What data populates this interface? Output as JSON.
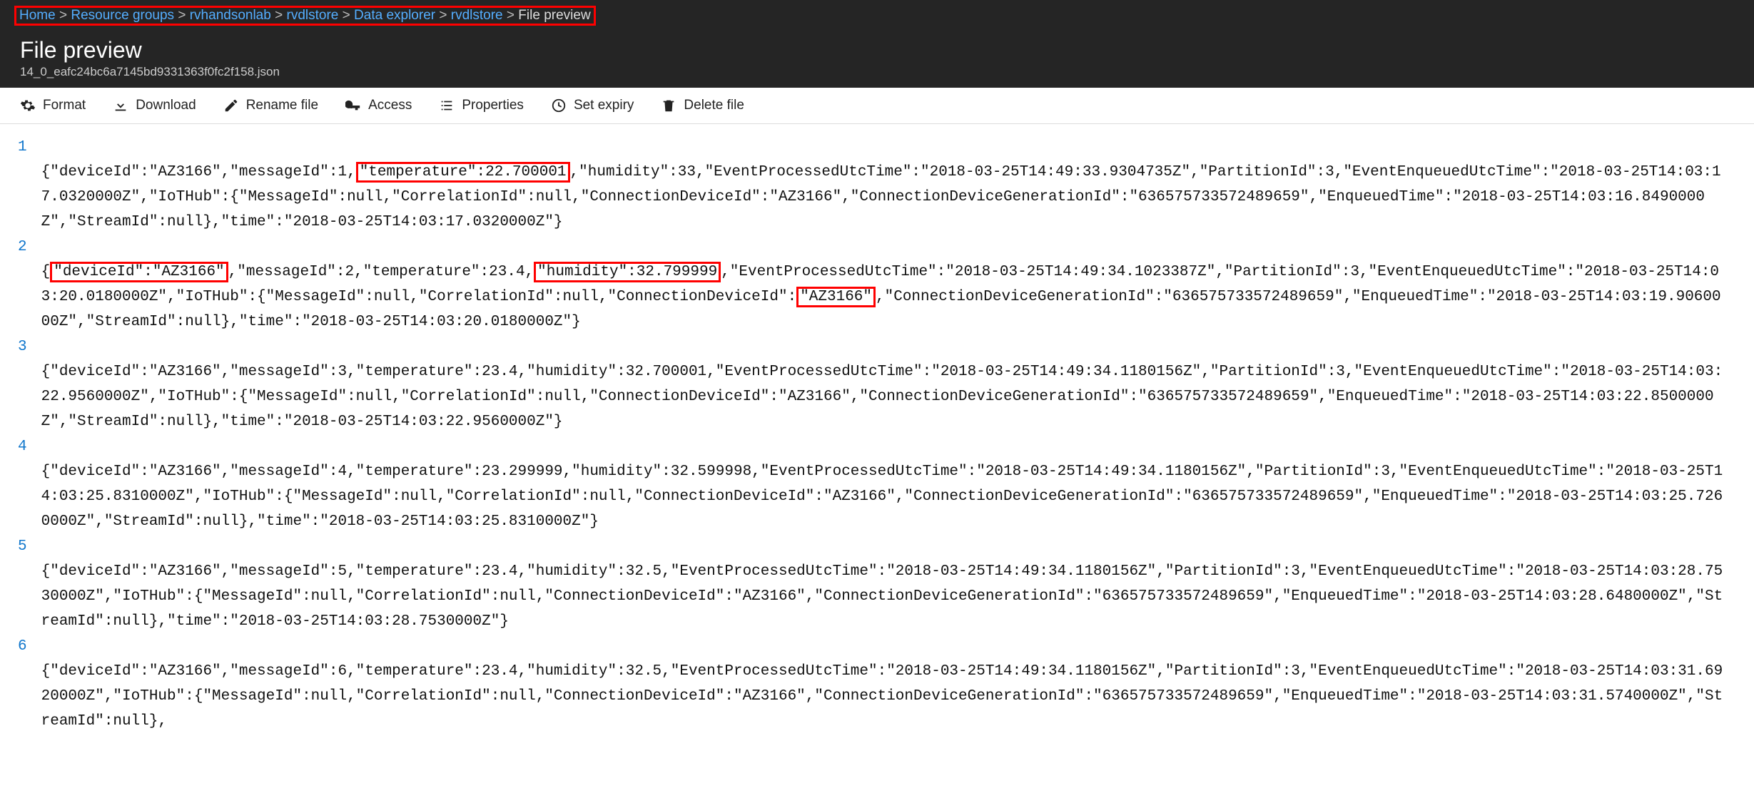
{
  "breadcrumb": {
    "items": [
      "Home",
      "Resource groups",
      "rvhandsonlab",
      "rvdlstore",
      "Data explorer",
      "rvdlstore",
      "File preview"
    ]
  },
  "header": {
    "title": "File preview",
    "subtitle": "14_0_eafc24bc6a7145bd9331363f0fc2f158.json"
  },
  "toolbar": {
    "format": "Format",
    "download": "Download",
    "rename": "Rename file",
    "access": "Access",
    "properties": "Properties",
    "setexpiry": "Set expiry",
    "deletefile": "Delete file"
  },
  "records": [
    {
      "n": 1,
      "pre": "{\"deviceId\":\"AZ3166\",\"messageId\":1,",
      "hl1": "\"temperature\":22.700001",
      "mid": ",\"humidity\":33,\"EventProcessedUtcTime\":\"2018-03-25T14:49:33.9304735Z\",\"PartitionId\":3,\"EventEnqueuedUtcTime\":\"2018-03-25T14:03:17.0320000Z\",\"IoTHub\":{\"MessageId\":null,\"CorrelationId\":null,\"ConnectionDeviceId\":\"AZ3166\",\"ConnectionDeviceGenerationId\":\"636575733572489659\",\"EnqueuedTime\":\"2018-03-25T14:03:16.8490000Z\",\"StreamId\":null},\"time\":\"2018-03-25T14:03:17.0320000Z\"}"
    },
    {
      "n": 2,
      "pre": "{",
      "hl1": "\"deviceId\":\"AZ3166\"",
      "mid1": ",\"messageId\":2,\"temperature\":23.4,",
      "hl2": "\"humidity\":32.799999",
      "mid2": ",\"EventProcessedUtcTime\":\"2018-03-25T14:49:34.1023387Z\",\"PartitionId\":3,\"EventEnqueuedUtcTime\":\"2018-03-25T14:03:20.0180000Z\",\"IoTHub\":{\"MessageId\":null,\"CorrelationId\":null,\"ConnectionDeviceId\":",
      "hl3": "\"AZ3166\"",
      "mid3": ",\"ConnectionDeviceGenerationId\":\"636575733572489659\",\"EnqueuedTime\":\"2018-03-25T14:03:19.9060000Z\",\"StreamId\":null},\"time\":\"2018-03-25T14:03:20.0180000Z\"}"
    },
    {
      "n": 3,
      "text": "{\"deviceId\":\"AZ3166\",\"messageId\":3,\"temperature\":23.4,\"humidity\":32.700001,\"EventProcessedUtcTime\":\"2018-03-25T14:49:34.1180156Z\",\"PartitionId\":3,\"EventEnqueuedUtcTime\":\"2018-03-25T14:03:22.9560000Z\",\"IoTHub\":{\"MessageId\":null,\"CorrelationId\":null,\"ConnectionDeviceId\":\"AZ3166\",\"ConnectionDeviceGenerationId\":\"636575733572489659\",\"EnqueuedTime\":\"2018-03-25T14:03:22.8500000Z\",\"StreamId\":null},\"time\":\"2018-03-25T14:03:22.9560000Z\"}"
    },
    {
      "n": 4,
      "text": "{\"deviceId\":\"AZ3166\",\"messageId\":4,\"temperature\":23.299999,\"humidity\":32.599998,\"EventProcessedUtcTime\":\"2018-03-25T14:49:34.1180156Z\",\"PartitionId\":3,\"EventEnqueuedUtcTime\":\"2018-03-25T14:03:25.8310000Z\",\"IoTHub\":{\"MessageId\":null,\"CorrelationId\":null,\"ConnectionDeviceId\":\"AZ3166\",\"ConnectionDeviceGenerationId\":\"636575733572489659\",\"EnqueuedTime\":\"2018-03-25T14:03:25.7260000Z\",\"StreamId\":null},\"time\":\"2018-03-25T14:03:25.8310000Z\"}"
    },
    {
      "n": 5,
      "text": "{\"deviceId\":\"AZ3166\",\"messageId\":5,\"temperature\":23.4,\"humidity\":32.5,\"EventProcessedUtcTime\":\"2018-03-25T14:49:34.1180156Z\",\"PartitionId\":3,\"EventEnqueuedUtcTime\":\"2018-03-25T14:03:28.7530000Z\",\"IoTHub\":{\"MessageId\":null,\"CorrelationId\":null,\"ConnectionDeviceId\":\"AZ3166\",\"ConnectionDeviceGenerationId\":\"636575733572489659\",\"EnqueuedTime\":\"2018-03-25T14:03:28.6480000Z\",\"StreamId\":null},\"time\":\"2018-03-25T14:03:28.7530000Z\"}"
    },
    {
      "n": 6,
      "text": "{\"deviceId\":\"AZ3166\",\"messageId\":6,\"temperature\":23.4,\"humidity\":32.5,\"EventProcessedUtcTime\":\"2018-03-25T14:49:34.1180156Z\",\"PartitionId\":3,\"EventEnqueuedUtcTime\":\"2018-03-25T14:03:31.6920000Z\",\"IoTHub\":{\"MessageId\":null,\"CorrelationId\":null,\"ConnectionDeviceId\":\"AZ3166\",\"ConnectionDeviceGenerationId\":\"636575733572489659\",\"EnqueuedTime\":\"2018-03-25T14:03:31.5740000Z\",\"StreamId\":null},"
    }
  ]
}
